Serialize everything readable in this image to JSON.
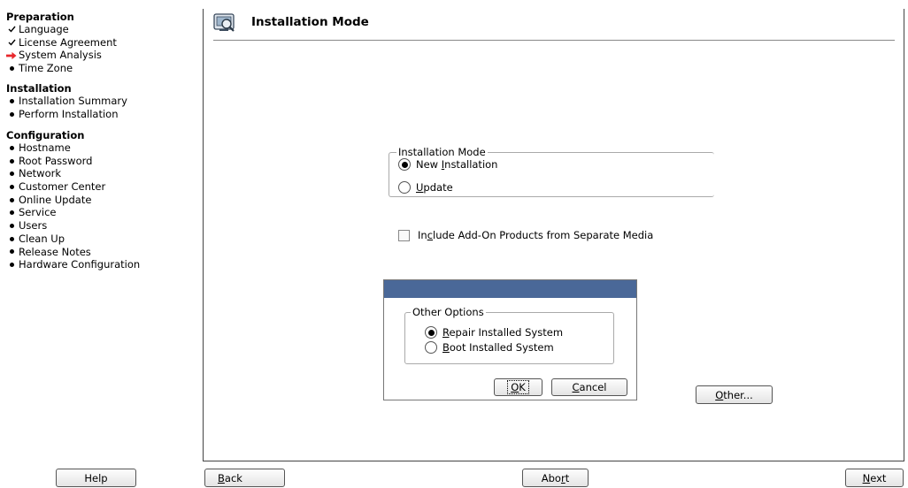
{
  "sidebar": {
    "preparation": {
      "title": "Preparation",
      "steps": [
        {
          "label": "Language",
          "state": "done"
        },
        {
          "label": "License Agreement",
          "state": "done"
        },
        {
          "label": "System Analysis",
          "state": "current"
        },
        {
          "label": "Time Zone",
          "state": "pending"
        }
      ]
    },
    "installation": {
      "title": "Installation",
      "steps": [
        {
          "label": "Installation Summary",
          "state": "pending"
        },
        {
          "label": "Perform Installation",
          "state": "pending"
        }
      ]
    },
    "configuration": {
      "title": "Configuration",
      "steps": [
        {
          "label": "Hostname",
          "state": "pending"
        },
        {
          "label": "Root Password",
          "state": "pending"
        },
        {
          "label": "Network",
          "state": "pending"
        },
        {
          "label": "Customer Center",
          "state": "pending"
        },
        {
          "label": "Online Update",
          "state": "pending"
        },
        {
          "label": "Service",
          "state": "pending"
        },
        {
          "label": "Users",
          "state": "pending"
        },
        {
          "label": "Clean Up",
          "state": "pending"
        },
        {
          "label": "Release Notes",
          "state": "pending"
        },
        {
          "label": "Hardware Configuration",
          "state": "pending"
        }
      ]
    }
  },
  "main": {
    "title": "Installation Mode",
    "title_icon": "installer-icon",
    "mode_group": {
      "legend": "Installation Mode",
      "options": [
        {
          "pre": "New ",
          "u": "I",
          "post": "nstallation",
          "selected": true
        },
        {
          "pre": "",
          "u": "U",
          "post": "pdate",
          "selected": false
        }
      ]
    },
    "addon": {
      "pre": "In",
      "u": "c",
      "post": "lude Add-On Products from Separate Media",
      "checked": false
    },
    "other_button": {
      "pre": "",
      "u": "O",
      "post": "ther..."
    }
  },
  "dialog": {
    "group_legend": "Other Options",
    "options": [
      {
        "pre": "",
        "u": "R",
        "post": "epair Installed System",
        "selected": true
      },
      {
        "pre": "",
        "u": "B",
        "post": "oot Installed System",
        "selected": false
      }
    ],
    "ok": {
      "pre": "",
      "u": "O",
      "post": "K"
    },
    "cancel": {
      "pre": "",
      "u": "C",
      "post": "ancel"
    }
  },
  "footer": {
    "help": "Help",
    "back": {
      "pre": "",
      "u": "B",
      "post": "ack"
    },
    "abort": {
      "pre": "Abo",
      "u": "r",
      "post": "t"
    },
    "next": {
      "pre": "",
      "u": "N",
      "post": "ext"
    }
  },
  "colors": {
    "dialog_titlebar": "#4a6898",
    "current_step_arrow": "#e8282c"
  }
}
